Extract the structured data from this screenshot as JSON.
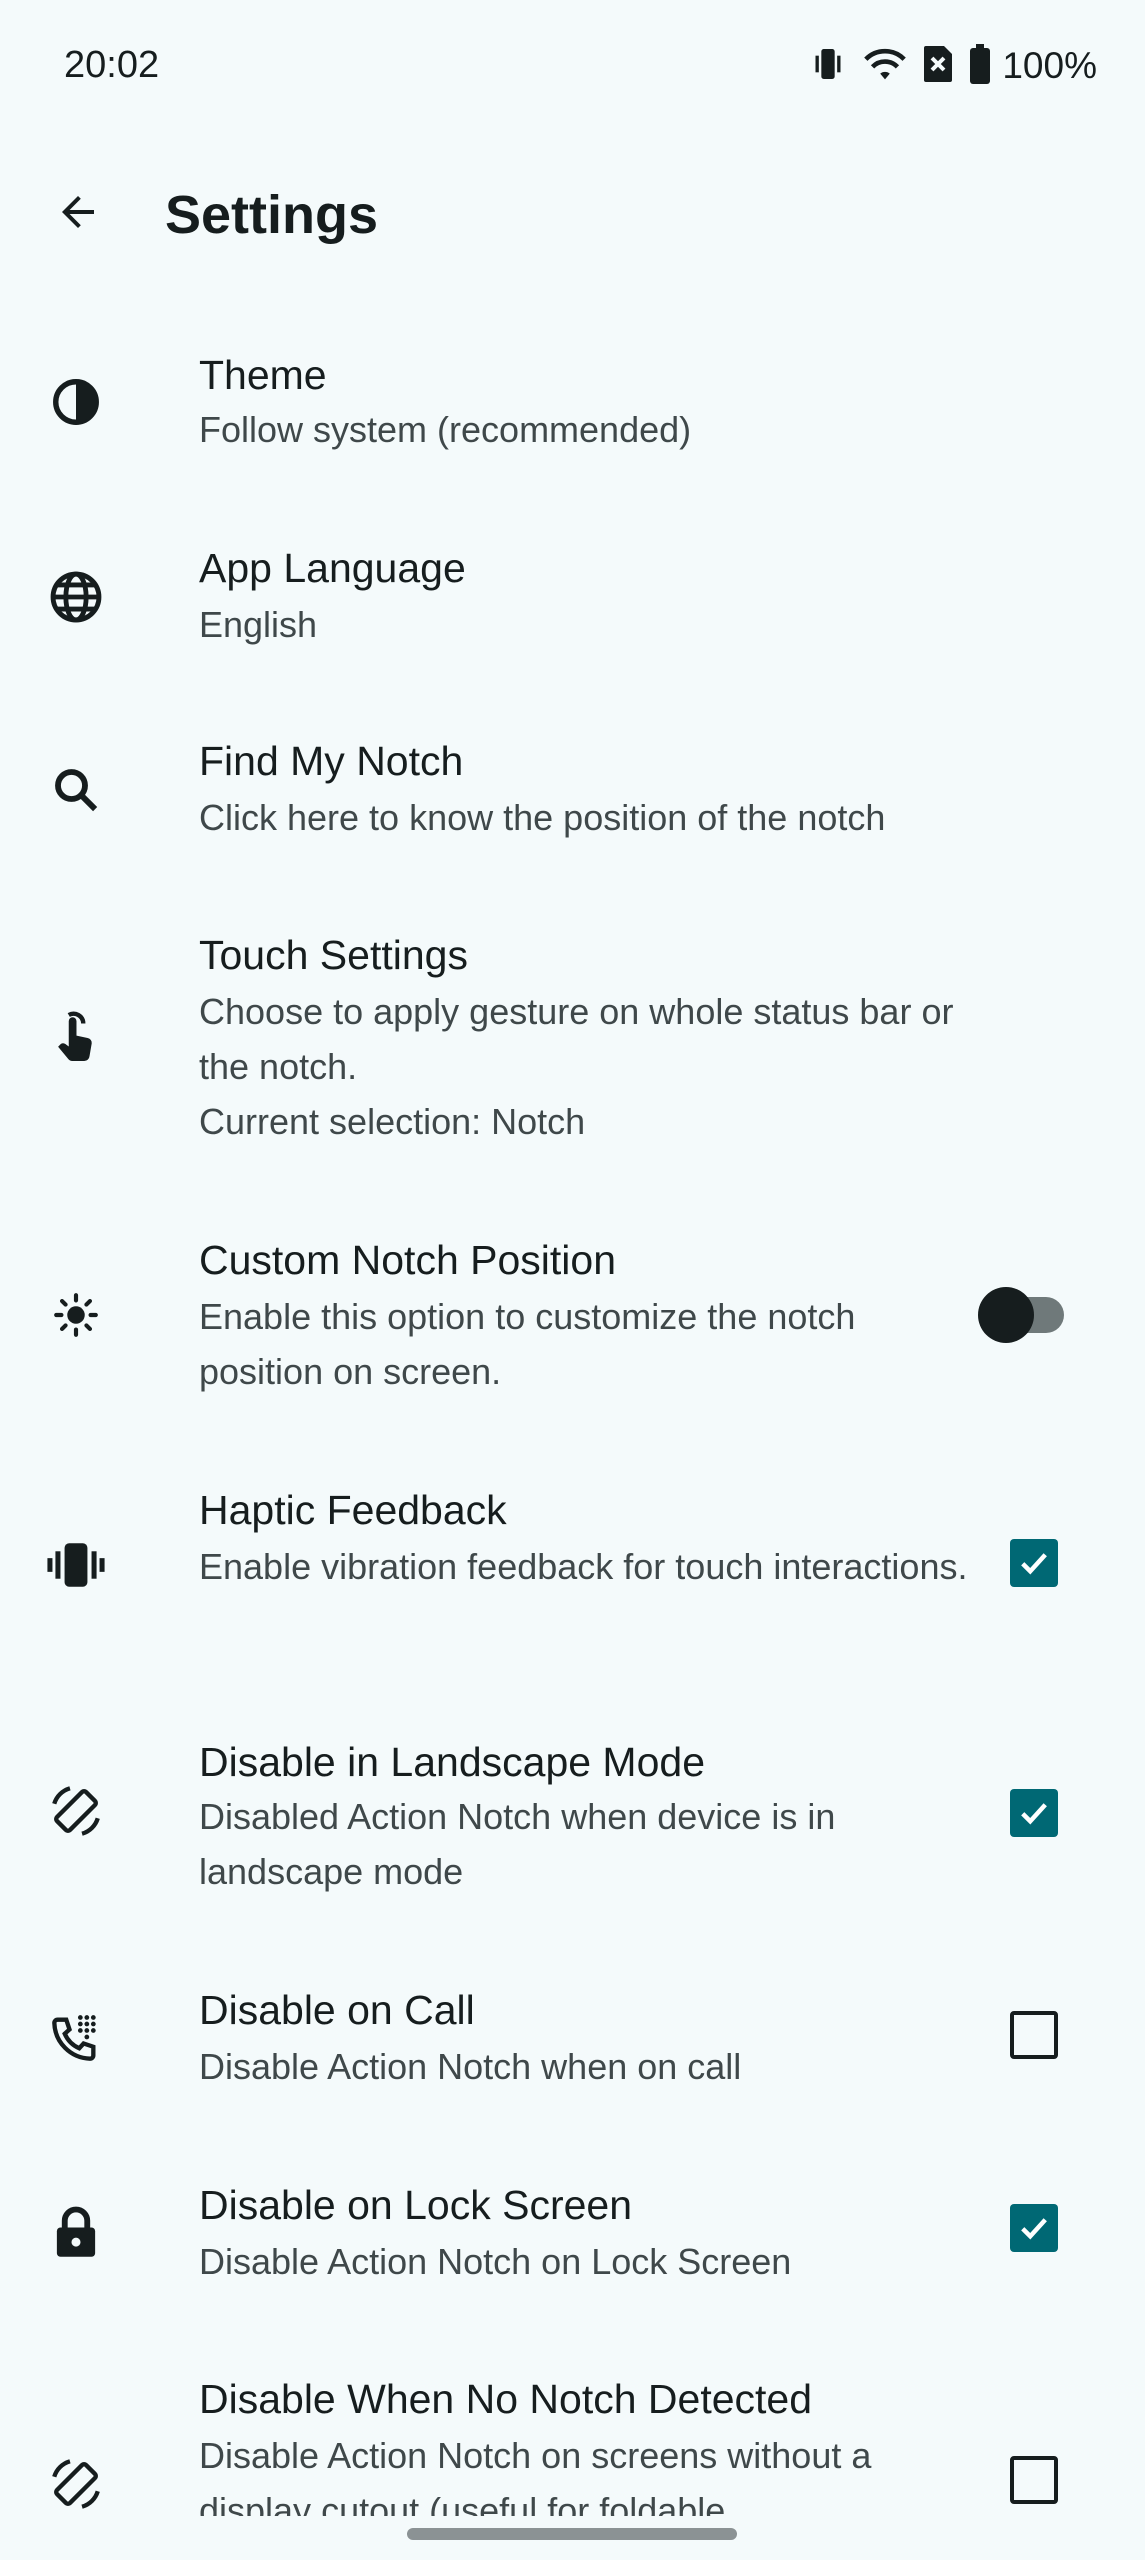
{
  "status_bar": {
    "time": "20:02",
    "battery": "100%",
    "icons": [
      "vibrate-icon",
      "wifi-icon",
      "no-sim-icon",
      "battery-icon"
    ]
  },
  "app_bar": {
    "title": "Settings",
    "back_icon": "arrow-back-icon"
  },
  "colors": {
    "accent": "#006874",
    "background": "#f4fafb",
    "text_primary": "#161d1e",
    "text_secondary": "#3f484a"
  },
  "settings": [
    {
      "id": "theme",
      "icon": "contrast-icon",
      "title": "Theme",
      "subtitle": [
        "Follow system (recommended)"
      ],
      "control": "none"
    },
    {
      "id": "app-language",
      "icon": "globe-icon",
      "title": "App Language",
      "subtitle": [
        "English"
      ],
      "control": "none"
    },
    {
      "id": "find-my-notch",
      "icon": "search-icon",
      "title": "Find My Notch",
      "subtitle": [
        "Click here to know the position of the notch"
      ],
      "control": "none"
    },
    {
      "id": "touch-settings",
      "icon": "touch-icon",
      "title": "Touch Settings",
      "subtitle": [
        "Choose to apply gesture on whole status bar or the notch.",
        "Current selection: Notch"
      ],
      "control": "none"
    },
    {
      "id": "custom-notch-position",
      "icon": "brightness-icon",
      "title": "Custom Notch Position",
      "subtitle": [
        "Enable this option to customize the notch position on screen."
      ],
      "control": "toggle",
      "checked": false
    },
    {
      "id": "haptic-feedback",
      "icon": "vibration-icon",
      "title": "Haptic Feedback",
      "subtitle": [
        "Enable vibration feedback for touch interactions."
      ],
      "control": "checkbox",
      "checked": true
    },
    {
      "id": "disable-landscape",
      "icon": "screen-rotation-icon",
      "title": "Disable in Landscape Mode",
      "subtitle": [
        "Disabled Action Notch when device is in landscape mode"
      ],
      "control": "checkbox",
      "checked": true
    },
    {
      "id": "disable-on-call",
      "icon": "dialpad-phone-icon",
      "title": "Disable on Call",
      "subtitle": [
        "Disable Action Notch when on call"
      ],
      "control": "checkbox",
      "checked": false
    },
    {
      "id": "disable-lock-screen",
      "icon": "lock-icon",
      "title": "Disable on Lock Screen",
      "subtitle": [
        "Disable Action Notch on Lock Screen"
      ],
      "control": "checkbox",
      "checked": true
    },
    {
      "id": "disable-no-notch",
      "icon": "screen-rotation-icon",
      "title": "Disable When No Notch Detected",
      "subtitle": [
        "Disable Action Notch on screens without a display cutout (useful for foldable"
      ],
      "control": "checkbox",
      "checked": false
    }
  ]
}
